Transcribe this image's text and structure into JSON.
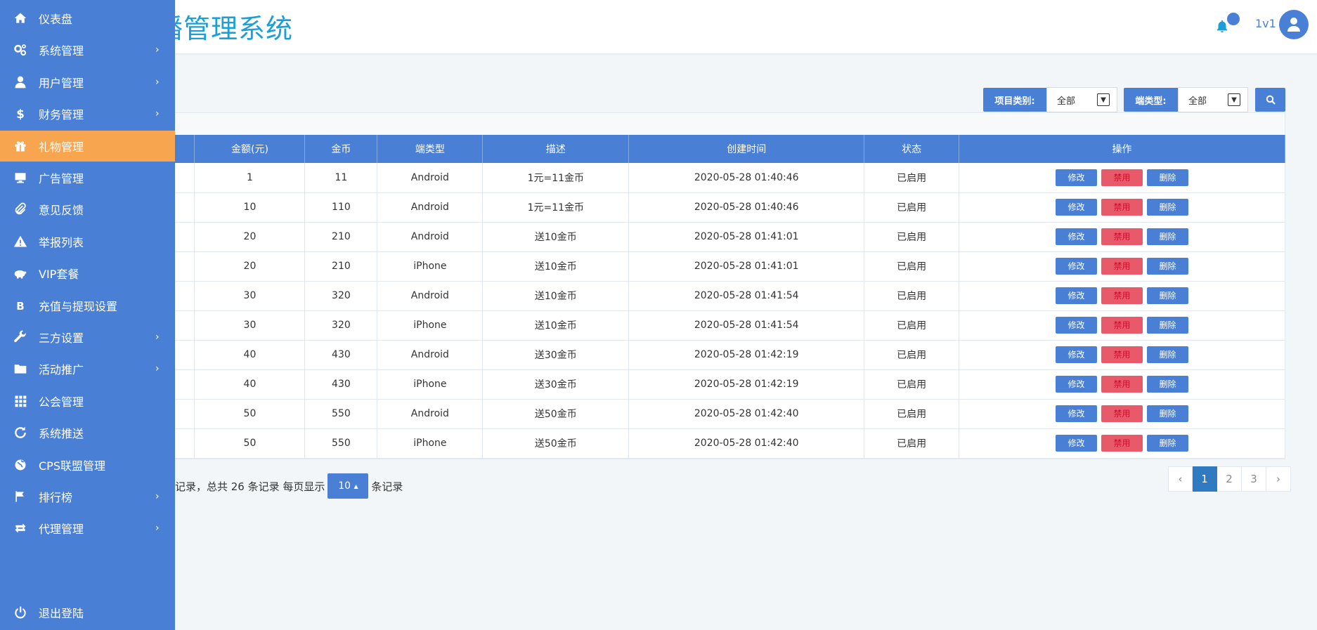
{
  "header": {
    "title": "播管理系统",
    "user": "1v1"
  },
  "sidebar": {
    "items": [
      {
        "label": "仪表盘",
        "icon": "home-icon",
        "chev": false
      },
      {
        "label": "系统管理",
        "icon": "cogs-icon",
        "chev": true
      },
      {
        "label": "用户管理",
        "icon": "user-icon",
        "chev": true
      },
      {
        "label": "财务管理",
        "icon": "dollar-icon",
        "chev": true
      },
      {
        "label": "礼物管理",
        "icon": "gift-icon",
        "chev": false,
        "active": true
      },
      {
        "label": "广告管理",
        "icon": "desktop-icon",
        "chev": false
      },
      {
        "label": "意见反馈",
        "icon": "paperclip-icon",
        "chev": false
      },
      {
        "label": "举报列表",
        "icon": "warning-icon",
        "chev": false
      },
      {
        "label": "VIP套餐",
        "icon": "piggybank-icon",
        "chev": false
      },
      {
        "label": "充值与提现设置",
        "icon": "bitcoin-icon",
        "chev": false
      },
      {
        "label": "三方设置",
        "icon": "wrench-icon",
        "chev": true
      },
      {
        "label": "活动推广",
        "icon": "folder-icon",
        "chev": true
      },
      {
        "label": "公会管理",
        "icon": "grid-icon",
        "chev": false
      },
      {
        "label": "系统推送",
        "icon": "refresh-icon",
        "chev": false
      },
      {
        "label": "CPS联盟管理",
        "icon": "globe-icon",
        "chev": false
      },
      {
        "label": "排行榜",
        "icon": "flag-icon",
        "chev": true
      },
      {
        "label": "代理管理",
        "icon": "retweet-icon",
        "chev": true
      }
    ],
    "logout": "退出登陆"
  },
  "filters": {
    "type_label": "项目类别:",
    "type_value": "全部",
    "client_label": "端类型:",
    "client_value": "全部"
  },
  "table": {
    "headers": [
      "金额(元)",
      "金币",
      "端类型",
      "描述",
      "创建时间",
      "状态",
      "操作"
    ],
    "rows": [
      [
        "1",
        "11",
        "Android",
        "1元=11金币",
        "2020-05-28 01:40:46",
        "已启用"
      ],
      [
        "10",
        "110",
        "Android",
        "1元=11金币",
        "2020-05-28 01:40:46",
        "已启用"
      ],
      [
        "20",
        "210",
        "Android",
        "送10金币",
        "2020-05-28 01:41:01",
        "已启用"
      ],
      [
        "20",
        "210",
        "iPhone",
        "送10金币",
        "2020-05-28 01:41:01",
        "已启用"
      ],
      [
        "30",
        "320",
        "Android",
        "送10金币",
        "2020-05-28 01:41:54",
        "已启用"
      ],
      [
        "30",
        "320",
        "iPhone",
        "送10金币",
        "2020-05-28 01:41:54",
        "已启用"
      ],
      [
        "40",
        "430",
        "Android",
        "送30金币",
        "2020-05-28 01:42:19",
        "已启用"
      ],
      [
        "40",
        "430",
        "iPhone",
        "送30金币",
        "2020-05-28 01:42:19",
        "已启用"
      ],
      [
        "50",
        "550",
        "Android",
        "送50金币",
        "2020-05-28 01:42:40",
        "已启用"
      ],
      [
        "50",
        "550",
        "iPhone",
        "送50金币",
        "2020-05-28 01:42:40",
        "已启用"
      ]
    ],
    "actions": {
      "edit": "修改",
      "disable": "禁用",
      "delete": "删除"
    }
  },
  "footer": {
    "prefix": "记录，总共 26 条记录 每页显示",
    "page_size": "10",
    "suffix": "条记录",
    "pages": [
      "‹",
      "1",
      "2",
      "3",
      "›"
    ],
    "current_page": "1"
  },
  "colors": {
    "primary": "#4a7fd6",
    "active": "#f7a54f",
    "title": "#1a9fd9"
  }
}
